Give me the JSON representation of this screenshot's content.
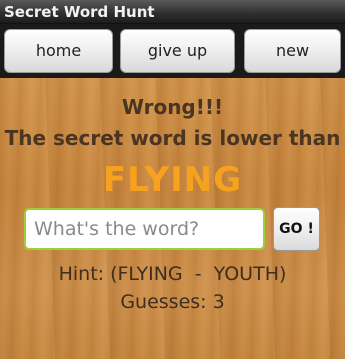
{
  "app": {
    "title": "Secret Word Hunt"
  },
  "toolbar": {
    "home_label": "home",
    "give_up_label": "give up",
    "new_label": "new"
  },
  "message": {
    "line1": "Wrong!!!",
    "line2": "The secret word is lower than",
    "word": "FLYING"
  },
  "input": {
    "placeholder": "What's the word?",
    "value": ""
  },
  "go_button": {
    "label": "GO !"
  },
  "hint": {
    "text": "Hint: (FLYING  -  YOUTH)"
  },
  "guesses": {
    "text": "Guesses: 3"
  },
  "colors": {
    "word_highlight": "#f7a21e",
    "input_border": "#9ccf3a",
    "text_brown": "#4a3522"
  }
}
